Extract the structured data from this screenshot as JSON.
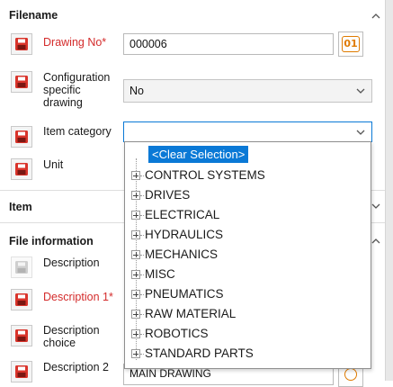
{
  "sections": {
    "filename": {
      "title": "Filename"
    },
    "item": {
      "title": "Item"
    },
    "file_information": {
      "title": "File information"
    }
  },
  "fields": {
    "drawing_no": {
      "label": "Drawing No*",
      "value": "000006",
      "counter_button": "01"
    },
    "configuration_specific_drawing": {
      "label_lines": [
        "Configuration",
        "specific",
        "drawing"
      ],
      "value": "No"
    },
    "item_category": {
      "label": "Item category",
      "value": ""
    },
    "unit": {
      "label": "Unit"
    },
    "description": {
      "label": "Description"
    },
    "description_1": {
      "label": "Description 1*"
    },
    "description_choice": {
      "label_lines": [
        "Description",
        "choice"
      ]
    },
    "description_2": {
      "label": "Description 2",
      "value": "MAIN DRAWING"
    }
  },
  "dropdown": {
    "clear_selection": "<Clear Selection>",
    "options": [
      "CONTROL SYSTEMS",
      "DRIVES",
      "ELECTRICAL",
      "HYDRAULICS",
      "MECHANICS",
      "MISC",
      "PNEUMATICS",
      "RAW MATERIAL",
      "ROBOTICS",
      "STANDARD PARTS"
    ]
  },
  "colors": {
    "required_label": "#d42b2b",
    "save_icon": "#d9342b",
    "counter_accent": "#e07b00",
    "selection": "#0a79d6"
  },
  "icons": {
    "save": "save-icon",
    "collapse": "chevron-up-icon",
    "expand": "chevron-down-icon",
    "tree_expand": "plus-box-icon"
  }
}
